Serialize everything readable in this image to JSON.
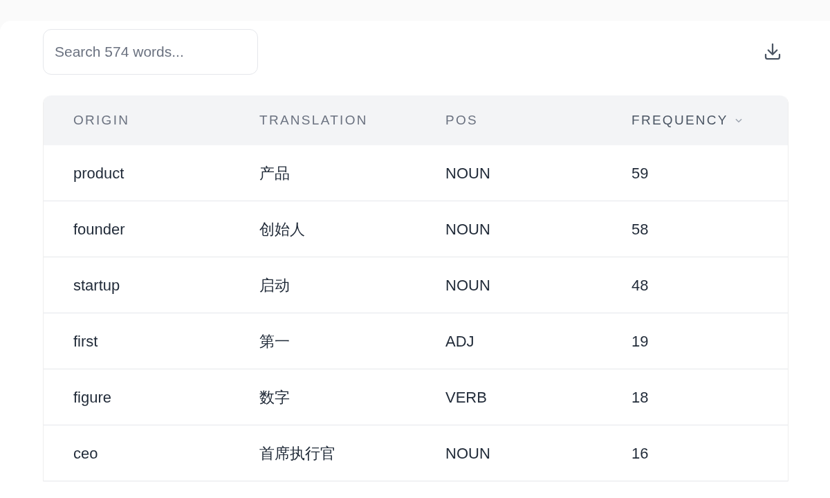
{
  "search": {
    "placeholder": "Search 574 words..."
  },
  "table": {
    "columns": [
      {
        "label": "ORIGIN",
        "sorted": false
      },
      {
        "label": "TRANSLATION",
        "sorted": false
      },
      {
        "label": "POS",
        "sorted": false
      },
      {
        "label": "FREQUENCY",
        "sorted": true
      }
    ],
    "rows": [
      [
        "product",
        "产品",
        "NOUN",
        "59"
      ],
      [
        "founder",
        "创始人",
        "NOUN",
        "58"
      ],
      [
        "startup",
        "启动",
        "NOUN",
        "48"
      ],
      [
        "first",
        "第一",
        "ADJ",
        "19"
      ],
      [
        "figure",
        "数字",
        "VERB",
        "18"
      ],
      [
        "ceo",
        "首席执行官",
        "NOUN",
        "16"
      ]
    ]
  }
}
